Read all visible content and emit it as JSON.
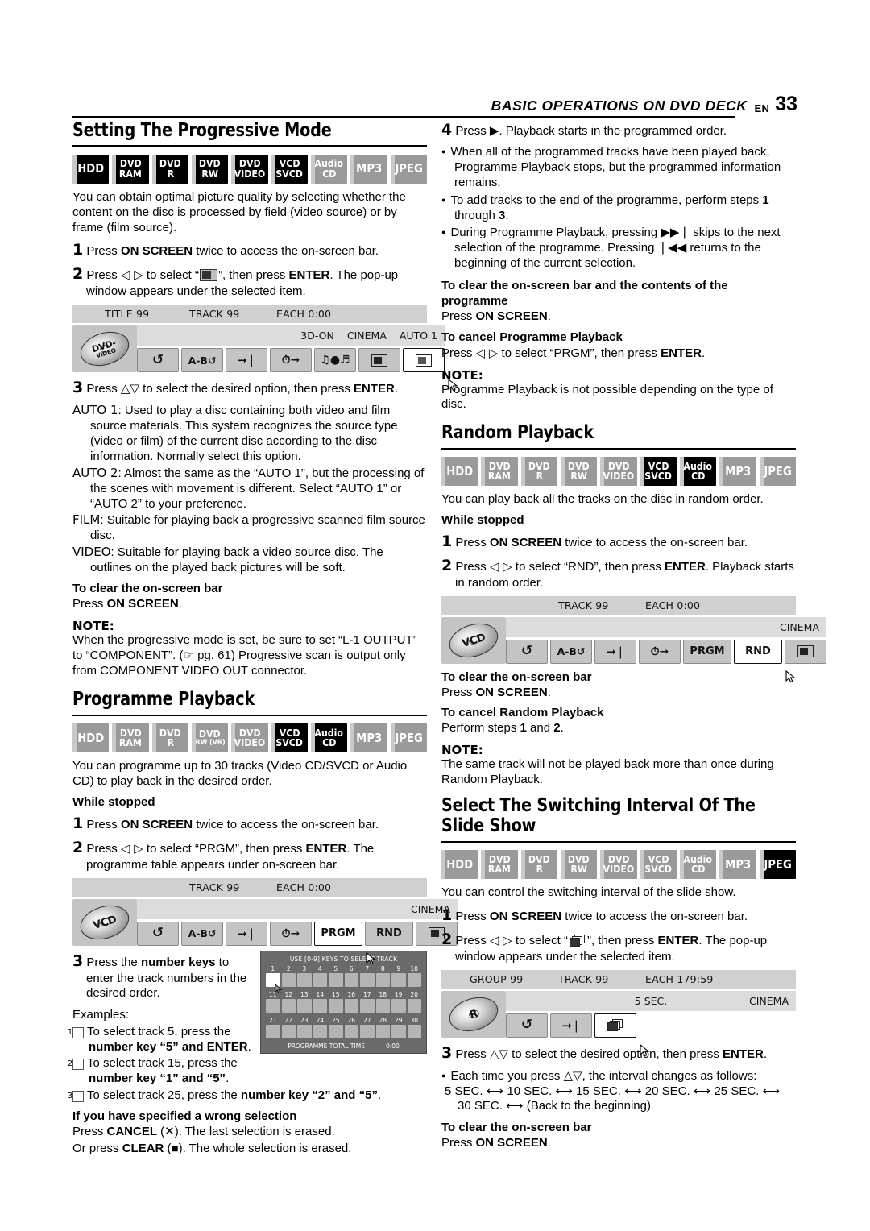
{
  "header": {
    "title": "BASIC OPERATIONS ON DVD DECK",
    "en": "EN",
    "page": "33"
  },
  "badge_labels": {
    "hdd": "HDD",
    "dvd": "DVD",
    "ram": "RAM",
    "r": "R",
    "rw": "RW",
    "rw_vr": "RW (VR)",
    "video": "VIDEO",
    "vcd": "VCD",
    "svcd": "SVCD",
    "audio": "Audio",
    "cd": "CD",
    "mp3": "MP3",
    "jpeg": "JPEG"
  },
  "sections": {
    "progressive": {
      "heading": "Setting The Progressive Mode",
      "badges_state": [
        "on",
        "on",
        "on",
        "on",
        "on",
        "on",
        "off",
        "off",
        "off"
      ],
      "intro": "You can obtain optimal picture quality by selecting whether the content on the disc is processed by field (video source) or by frame (film source).",
      "step1_num": "1",
      "step1_a": "Press ",
      "step1_b": "ON SCREEN",
      "step1_c": " twice to access the on-screen bar.",
      "step2_num": "2",
      "step2_a": "Press ",
      "step2_arrows": "◁ ▷",
      "step2_b": " to select “",
      "step2_c": "”, then press ",
      "step2_d": "ENTER",
      "step2_e": ". The pop-up window appears under the selected item.",
      "step3_num": "3",
      "step3_a": "Press ",
      "step3_arrows": "△▽",
      "step3_b": " to select the desired option, then press ",
      "step3_c": "ENTER",
      "step3_d": ".",
      "defs": [
        {
          "term": "AUTO 1",
          "text": ": Used to play a disc containing both video and film source materials. This system recognizes the source type (video or film) of the current disc according to the disc information. Normally select this option."
        },
        {
          "term": "AUTO 2",
          "text": ": Almost the same as the “AUTO 1”, but the processing of the scenes with movement is different. Select “AUTO 1” or “AUTO 2” to your preference."
        },
        {
          "term": "FILM",
          "text": ": Suitable for playing back a progressive scanned film source disc."
        },
        {
          "term": "VIDEO",
          "text": ": Suitable for playing back a video source disc. The outlines on the played back pictures will be soft."
        }
      ],
      "clear_h": "To clear the on-screen bar",
      "clear_a": "Press ",
      "clear_b": "ON SCREEN",
      "clear_c": ".",
      "note_h": "NOTE:",
      "note_text": "When the progressive mode is set, be sure to set “L-1 OUTPUT” to “COMPONENT”. (☞ pg. 61) Progressive scan is output only from COMPONENT VIDEO OUT connector.",
      "osb": {
        "top": {
          "title": "TITLE 99",
          "track": "TRACK 99",
          "each": "EACH 0:00"
        },
        "disc": {
          "line1": "DVD-",
          "line2": "VIDEO"
        },
        "status": [
          "3D-ON",
          "CINEMA",
          "AUTO 1"
        ],
        "buttons": [
          "repeat",
          "a-b-repeat",
          "skip",
          "time-skip",
          "audio",
          "screen-mode",
          "progressive"
        ],
        "selected": "progressive"
      }
    },
    "programme": {
      "heading": "Programme Playback",
      "badges_state": [
        "off",
        "off",
        "off",
        "off",
        "off",
        "on",
        "on",
        "off",
        "off"
      ],
      "intro": "You can programme up to 30 tracks (Video CD/SVCD or Audio CD) to play back in the desired order.",
      "while_stopped": "While stopped",
      "step1_num": "1",
      "step1_a": "Press ",
      "step1_b": "ON SCREEN",
      "step1_c": " twice to access the on-screen bar.",
      "step2_num": "2",
      "step2_a": "Press ",
      "step2_arrows": "◁ ▷",
      "step2_b": " to select “PRGM”, then press ",
      "step2_c": "ENTER",
      "step2_d": ". The programme table appears under on-screen bar.",
      "step3_num": "3",
      "step3_a": "Press the ",
      "step3_b": "number keys",
      "step3_c": " to enter the track numbers in the desired order.",
      "examples_h": "Examples:",
      "examples": [
        {
          "n": "1",
          "a": "To select track 5, press the ",
          "b": "number key “5” and ENTER",
          "c": "."
        },
        {
          "n": "2",
          "a": "To select track 15, press the ",
          "b": "number key “1” and “5”",
          "c": "."
        },
        {
          "n": "3",
          "a": "To select track 25, press the ",
          "b": "number key “2” and “5”",
          "c": "."
        }
      ],
      "wrong_h": "If you have specified a wrong selection",
      "wrong_1a": "Press ",
      "wrong_1b": "CANCEL",
      "wrong_1c": " (✕). The last selection is erased.",
      "wrong_2a": "Or press ",
      "wrong_2b": "CLEAR",
      "wrong_2c": " (■). The whole selection is erased.",
      "osb": {
        "top": {
          "track": "TRACK 99",
          "each": "EACH 0:00"
        },
        "disc": {
          "line1": "VCD"
        },
        "status": [
          "CINEMA"
        ],
        "buttons": [
          "repeat",
          "a-b-repeat",
          "skip",
          "time-skip",
          "PRGM",
          "RND",
          "screen-mode"
        ],
        "selected": "PRGM"
      },
      "table": {
        "title": "USE [0-9] KEYS TO SELECT TRACK",
        "rows": [
          [
            "1",
            "2",
            "3",
            "4",
            "5",
            "6",
            "7",
            "8",
            "9",
            "10"
          ],
          [
            "11",
            "12",
            "13",
            "14",
            "15",
            "16",
            "17",
            "18",
            "19",
            "20"
          ],
          [
            "21",
            "22",
            "23",
            "24",
            "25",
            "26",
            "27",
            "28",
            "29",
            "30"
          ]
        ],
        "selected_cell": 0,
        "foot_label": "PROGRAMME TOTAL TIME",
        "foot_time": "0:00"
      }
    },
    "programme_right": {
      "step4_num": "4",
      "step4_a": "Press ",
      "step4_play": "▶",
      "step4_b": ". Playback starts in the programmed order.",
      "bullets": [
        {
          "parts": [
            {
              "t": "When all of the programmed tracks have been played back, Programme Playback stops, but the programmed information remains.",
              "bold": false
            }
          ]
        },
        {
          "parts": [
            {
              "t": "To add tracks to the end of the programme, perform steps ",
              "bold": false
            },
            {
              "t": "1",
              "bold": true
            },
            {
              "t": " through ",
              "bold": false
            },
            {
              "t": "3",
              "bold": true
            },
            {
              "t": ".",
              "bold": false
            }
          ]
        },
        {
          "parts": [
            {
              "t": "During Programme Playback, pressing ",
              "bold": false
            },
            {
              "t": "▶▶❘",
              "bold": false
            },
            {
              "t": " skips to the next selection of the programme. Pressing ",
              "bold": false
            },
            {
              "t": "❘◀◀",
              "bold": false
            },
            {
              "t": " returns to the beginning of the current selection.",
              "bold": false
            }
          ]
        }
      ],
      "clear_h": "To clear the on-screen bar and the contents of the programme",
      "clear_a": "Press ",
      "clear_b": "ON SCREEN",
      "clear_c": ".",
      "cancel_h": "To cancel Programme Playback",
      "cancel_a": "Press ",
      "cancel_arrows": "◁ ▷",
      "cancel_b": " to select “PRGM”, then press ",
      "cancel_c": "ENTER",
      "cancel_d": ".",
      "note_h": "NOTE:",
      "note_text": "Programme Playback is not possible depending on the type of disc."
    },
    "random": {
      "heading": "Random Playback",
      "badges_state": [
        "off",
        "off",
        "off",
        "off",
        "off",
        "on",
        "on",
        "off",
        "off"
      ],
      "intro": "You can play back all the tracks on the disc in random order.",
      "while_stopped": "While stopped",
      "step1_num": "1",
      "step1_a": "Press ",
      "step1_b": "ON SCREEN",
      "step1_c": " twice to access the on-screen bar.",
      "step2_num": "2",
      "step2_a": "Press ",
      "step2_arrows": "◁ ▷",
      "step2_b": " to select “RND”, then press ",
      "step2_c": "ENTER",
      "step2_d": ". Playback starts in random order.",
      "clear_h": "To clear the on-screen bar",
      "clear_a": "Press ",
      "clear_b": "ON SCREEN",
      "clear_c": ".",
      "cancel_h": "To cancel Random Playback",
      "cancel_a": "Perform steps ",
      "cancel_b": "1",
      "cancel_c": " and ",
      "cancel_d": "2",
      "cancel_e": ".",
      "note_h": "NOTE:",
      "note_text": "The same track will not be played back more than once during Random Playback.",
      "osb": {
        "top": {
          "track": "TRACK 99",
          "each": "EACH 0:00"
        },
        "disc": {
          "line1": "VCD"
        },
        "status": [
          "CINEMA"
        ],
        "buttons": [
          "repeat",
          "a-b-repeat",
          "skip",
          "time-skip",
          "PRGM",
          "RND",
          "screen-mode"
        ],
        "selected": "RND"
      }
    },
    "slideshow": {
      "heading": "Select The Switching Interval Of The Slide Show",
      "badges_state": [
        "off",
        "off",
        "off",
        "off",
        "off",
        "off",
        "off",
        "off",
        "on"
      ],
      "intro": "You can control the switching interval of the slide show.",
      "step1_num": "1",
      "step1_a": "Press ",
      "step1_b": "ON SCREEN",
      "step1_c": " twice to access the on-screen bar.",
      "step2_num": "2",
      "step2_a": "Press ",
      "step2_arrows": "◁ ▷",
      "step2_b": " to select “",
      "step2_c": "”, then press ",
      "step2_d": "ENTER",
      "step2_e": ". The pop-up window appears under the selected item.",
      "step3_num": "3",
      "step3_a": "Press ",
      "step3_arrows": "△▽",
      "step3_b": " to select the desired option, then press ",
      "step3_c": "ENTER",
      "step3_d": ".",
      "bullet_a": "Each time you press ",
      "bullet_arrows": "△▽",
      "bullet_b": ", the interval changes as follows:",
      "intervals": "5 SEC. ⟷ 10 SEC. ⟷ 15 SEC. ⟷ 20 SEC. ⟷ 25 SEC. ⟷ 30 SEC. ⟷ (Back to the beginning)",
      "clear_h": "To clear the on-screen bar",
      "clear_a": "Press ",
      "clear_b": "ON SCREEN",
      "clear_c": ".",
      "osb": {
        "top": {
          "group": "GROUP 99",
          "track": "TRACK 99",
          "each": "EACH 179:59"
        },
        "disc": {
          "line1": "R"
        },
        "status_center": "5 SEC.",
        "status": [
          "CINEMA"
        ],
        "buttons": [
          "repeat",
          "skip",
          "slide-show"
        ],
        "selected": "slide-show"
      }
    }
  }
}
